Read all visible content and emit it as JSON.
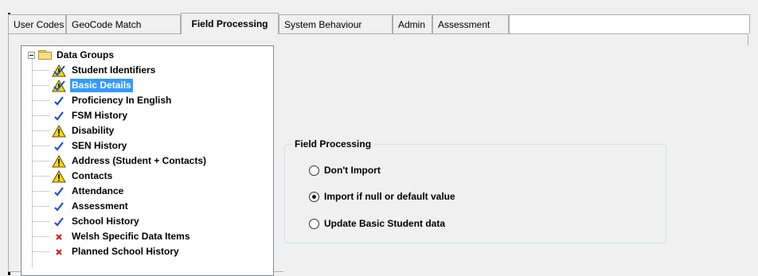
{
  "tabs": [
    {
      "label": "User Codes",
      "active": false
    },
    {
      "label": "GeoCode Match",
      "active": false
    },
    {
      "label": "Field Processing",
      "active": true
    },
    {
      "label": "System Behaviour",
      "active": false
    },
    {
      "label": "Admin",
      "active": false
    },
    {
      "label": "Assessment",
      "active": false
    }
  ],
  "tree": {
    "root_label": "Data Groups",
    "root_icon": "folder-icon",
    "items": [
      {
        "label": "Student Identifiers",
        "icon": "warning-checked-icon",
        "selected": false
      },
      {
        "label": "Basic Details",
        "icon": "warning-checked-icon",
        "selected": true
      },
      {
        "label": "Proficiency In English",
        "icon": "checkmark-icon",
        "selected": false
      },
      {
        "label": "FSM History",
        "icon": "checkmark-icon",
        "selected": false
      },
      {
        "label": "Disability",
        "icon": "warning-icon",
        "selected": false
      },
      {
        "label": "SEN History",
        "icon": "checkmark-icon",
        "selected": false
      },
      {
        "label": "Address (Student + Contacts)",
        "icon": "warning-icon",
        "selected": false
      },
      {
        "label": "Contacts",
        "icon": "warning-icon",
        "selected": false
      },
      {
        "label": "Attendance",
        "icon": "checkmark-icon",
        "selected": false
      },
      {
        "label": "Assessment",
        "icon": "checkmark-icon",
        "selected": false
      },
      {
        "label": "School History",
        "icon": "checkmark-icon",
        "selected": false
      },
      {
        "label": "Welsh Specific Data Items",
        "icon": "cross-icon",
        "selected": false
      },
      {
        "label": "Planned School History",
        "icon": "cross-icon",
        "selected": false
      }
    ]
  },
  "field_processing": {
    "title": "Field Processing",
    "options": [
      {
        "label": "Don't Import",
        "checked": false
      },
      {
        "label": "Import if null or default value",
        "checked": true
      },
      {
        "label": "Update Basic Student data",
        "checked": false
      }
    ]
  },
  "colors": {
    "selection": "#3399ff",
    "check": "#1a4fd6",
    "cross": "#d41f1f",
    "warning": "#f5d800"
  }
}
